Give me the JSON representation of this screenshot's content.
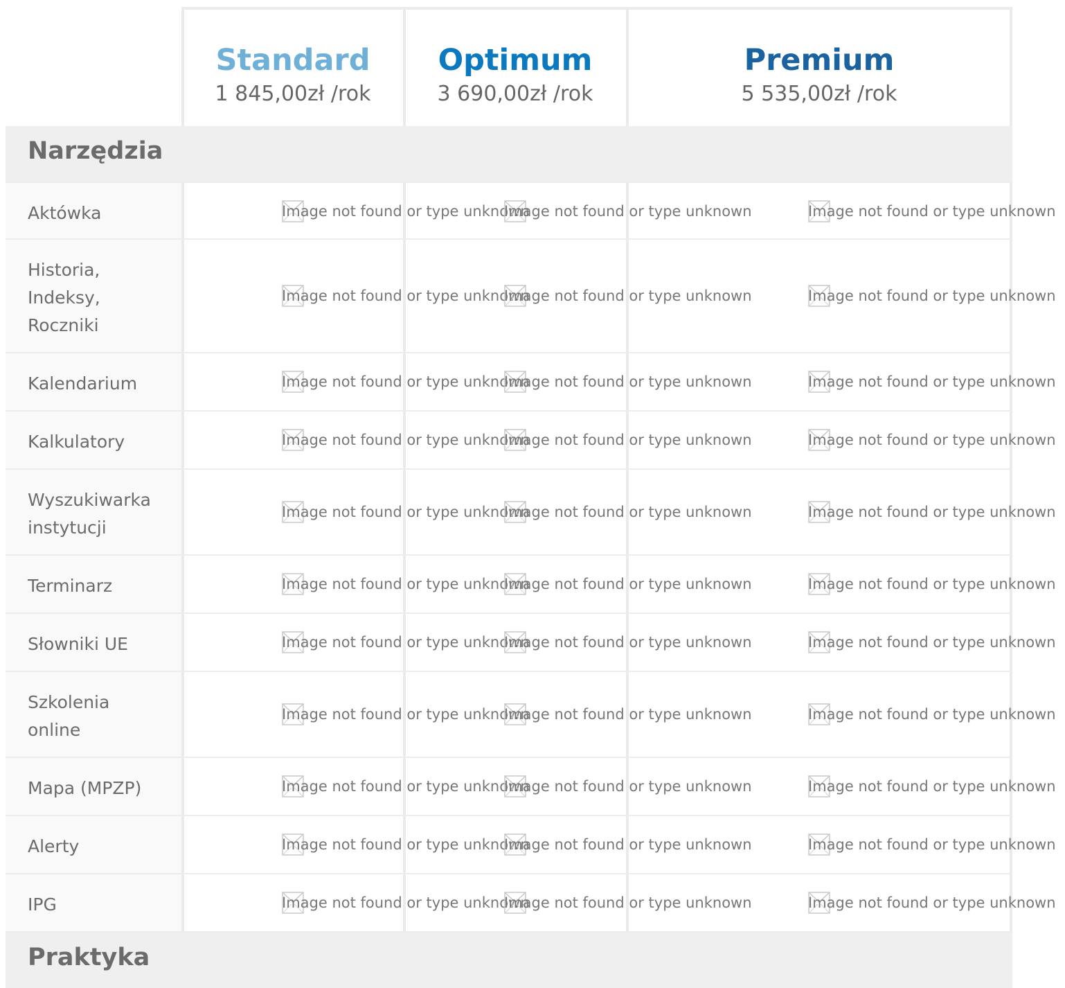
{
  "plans": [
    {
      "name": "Standard",
      "price": "1 845,00zł /rok",
      "color": "#6fb0d9"
    },
    {
      "name": "Optimum",
      "price": "3 690,00zł /rok",
      "color": "#0a79c0"
    },
    {
      "name": "Premium",
      "price": "5 535,00zł /rok",
      "color": "#1a63a0"
    }
  ],
  "sections": [
    {
      "title": "Narzędzia",
      "features": [
        "Aktówka",
        "Historia,\nIndeksy,\nRoczniki",
        "Kalendarium",
        "Kalkulatory",
        "Wyszukiwarka\ninstytucji",
        "Terminarz",
        "Słowniki UE",
        "Szkolenia\nonline",
        "Mapa (MPZP)",
        "Alerty",
        "IPG"
      ]
    },
    {
      "title": "Praktyka",
      "features": []
    }
  ],
  "broken_image_text": "Image not found or type unknown",
  "broken_image_icon": "broken-image-icon"
}
